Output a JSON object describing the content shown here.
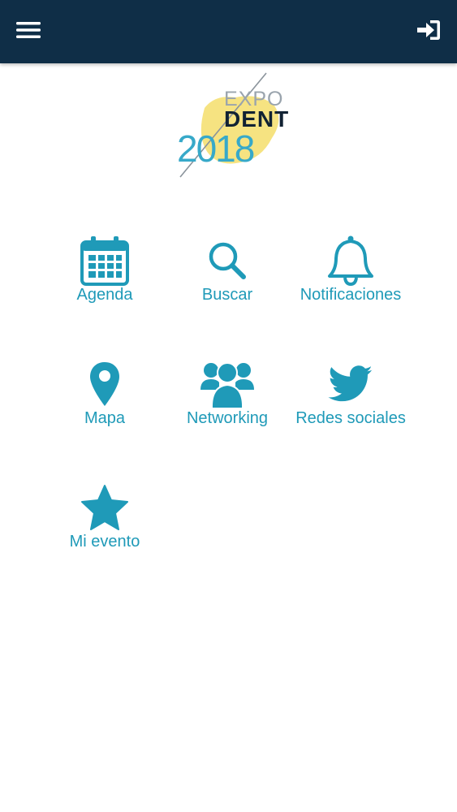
{
  "header": {
    "menu_icon": "hamburger-menu-icon",
    "login_icon": "sign-in-icon",
    "background_color": "#0f2e47"
  },
  "logo": {
    "line1": "EXPO",
    "line2": "DENT",
    "year": "2018"
  },
  "grid": {
    "accent_color": "#1f9ab8",
    "items": [
      {
        "label": "Agenda",
        "icon": "calendar-icon"
      },
      {
        "label": "Buscar",
        "icon": "search-icon"
      },
      {
        "label": "Notificaciones",
        "icon": "bell-icon"
      },
      {
        "label": "Mapa",
        "icon": "map-pin-icon"
      },
      {
        "label": "Networking",
        "icon": "users-icon"
      },
      {
        "label": "Redes sociales",
        "icon": "twitter-icon"
      },
      {
        "label": "Mi evento",
        "icon": "star-icon"
      }
    ]
  }
}
